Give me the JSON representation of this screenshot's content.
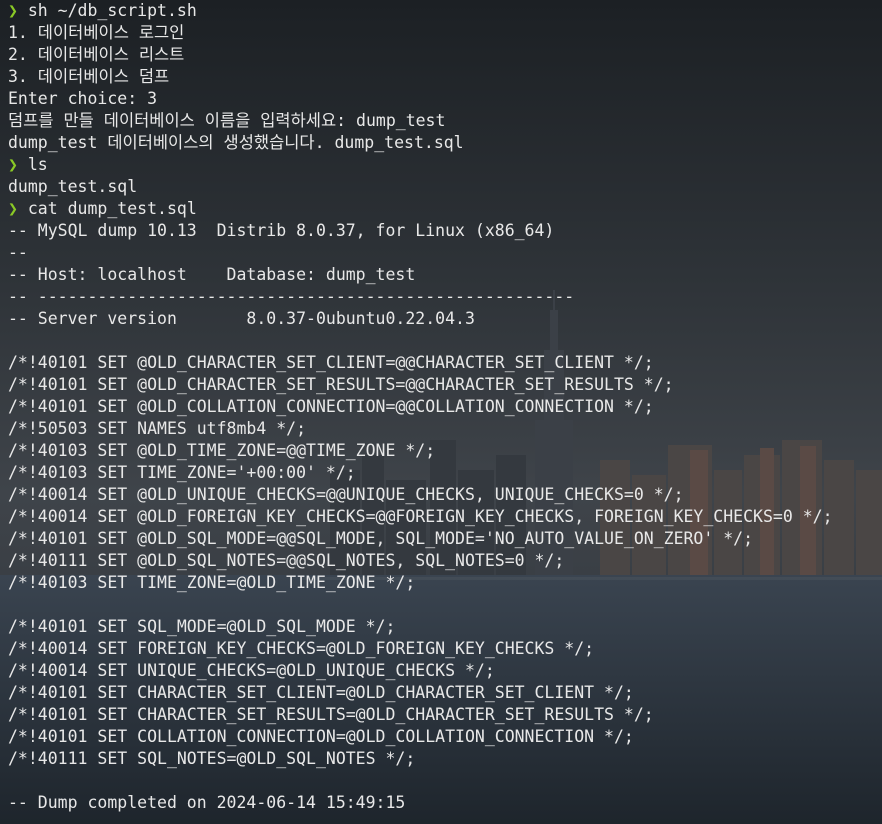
{
  "prompt_symbol": "❯",
  "colors": {
    "prompt": "#8ac926",
    "text": "#e8e8e8",
    "background": "#2b3036"
  },
  "lines": [
    {
      "type": "cmd",
      "text": "sh ~/db_script.sh"
    },
    {
      "type": "out",
      "text": "1. 데이터베이스 로그인"
    },
    {
      "type": "out",
      "text": "2. 데이터베이스 리스트"
    },
    {
      "type": "out",
      "text": "3. 데이터베이스 덤프"
    },
    {
      "type": "out",
      "text": "Enter choice: 3"
    },
    {
      "type": "out",
      "text": "덤프를 만들 데이터베이스 이름을 입력하세요: dump_test"
    },
    {
      "type": "out",
      "text": "dump_test 데이터베이스의 생성했습니다. dump_test.sql"
    },
    {
      "type": "cmd",
      "text": "ls"
    },
    {
      "type": "out",
      "text": "dump_test.sql"
    },
    {
      "type": "cmd",
      "text": "cat dump_test.sql"
    },
    {
      "type": "out",
      "text": "-- MySQL dump 10.13  Distrib 8.0.37, for Linux (x86_64)"
    },
    {
      "type": "out",
      "text": "--"
    },
    {
      "type": "out",
      "text": "-- Host: localhost    Database: dump_test"
    },
    {
      "type": "out",
      "text": "-- ------------------------------------------------------"
    },
    {
      "type": "out",
      "text": "-- Server version\t8.0.37-0ubuntu0.22.04.3"
    },
    {
      "type": "out",
      "text": ""
    },
    {
      "type": "out",
      "text": "/*!40101 SET @OLD_CHARACTER_SET_CLIENT=@@CHARACTER_SET_CLIENT */;"
    },
    {
      "type": "out",
      "text": "/*!40101 SET @OLD_CHARACTER_SET_RESULTS=@@CHARACTER_SET_RESULTS */;"
    },
    {
      "type": "out",
      "text": "/*!40101 SET @OLD_COLLATION_CONNECTION=@@COLLATION_CONNECTION */;"
    },
    {
      "type": "out",
      "text": "/*!50503 SET NAMES utf8mb4 */;"
    },
    {
      "type": "out",
      "text": "/*!40103 SET @OLD_TIME_ZONE=@@TIME_ZONE */;"
    },
    {
      "type": "out",
      "text": "/*!40103 SET TIME_ZONE='+00:00' */;"
    },
    {
      "type": "out",
      "text": "/*!40014 SET @OLD_UNIQUE_CHECKS=@@UNIQUE_CHECKS, UNIQUE_CHECKS=0 */;"
    },
    {
      "type": "out",
      "text": "/*!40014 SET @OLD_FOREIGN_KEY_CHECKS=@@FOREIGN_KEY_CHECKS, FOREIGN_KEY_CHECKS=0 */;"
    },
    {
      "type": "out",
      "text": "/*!40101 SET @OLD_SQL_MODE=@@SQL_MODE, SQL_MODE='NO_AUTO_VALUE_ON_ZERO' */;"
    },
    {
      "type": "out",
      "text": "/*!40111 SET @OLD_SQL_NOTES=@@SQL_NOTES, SQL_NOTES=0 */;"
    },
    {
      "type": "out",
      "text": "/*!40103 SET TIME_ZONE=@OLD_TIME_ZONE */;"
    },
    {
      "type": "out",
      "text": ""
    },
    {
      "type": "out",
      "text": "/*!40101 SET SQL_MODE=@OLD_SQL_MODE */;"
    },
    {
      "type": "out",
      "text": "/*!40014 SET FOREIGN_KEY_CHECKS=@OLD_FOREIGN_KEY_CHECKS */;"
    },
    {
      "type": "out",
      "text": "/*!40014 SET UNIQUE_CHECKS=@OLD_UNIQUE_CHECKS */;"
    },
    {
      "type": "out",
      "text": "/*!40101 SET CHARACTER_SET_CLIENT=@OLD_CHARACTER_SET_CLIENT */;"
    },
    {
      "type": "out",
      "text": "/*!40101 SET CHARACTER_SET_RESULTS=@OLD_CHARACTER_SET_RESULTS */;"
    },
    {
      "type": "out",
      "text": "/*!40101 SET COLLATION_CONNECTION=@OLD_COLLATION_CONNECTION */;"
    },
    {
      "type": "out",
      "text": "/*!40111 SET SQL_NOTES=@OLD_SQL_NOTES */;"
    },
    {
      "type": "out",
      "text": ""
    },
    {
      "type": "out",
      "text": "-- Dump completed on 2024-06-14 15:49:15"
    }
  ]
}
